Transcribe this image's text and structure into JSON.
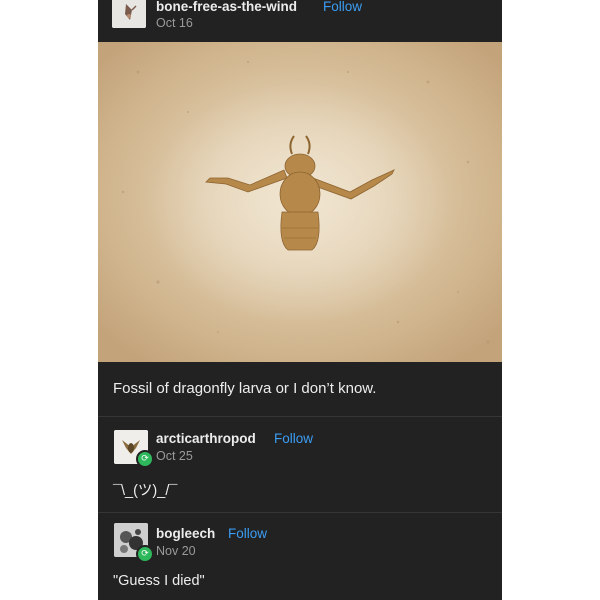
{
  "post": {
    "author": {
      "username": "bone-free-as-the-wind",
      "follow_label": "Follow",
      "date": "Oct 16"
    },
    "image": {
      "subject": "fossil",
      "background_color": "#cbb08d"
    },
    "caption": "Fossil of dragonfly larva or I don’t know."
  },
  "reblogs": [
    {
      "username": "arcticarthropod",
      "follow_label": "Follow",
      "date": "Oct 25",
      "text": "¯\\_(ツ)_/¯",
      "badge_icon": "reblog-icon"
    },
    {
      "username": "bogleech",
      "follow_label": "Follow",
      "date": "Nov 20",
      "text": "\"Guess I died\"",
      "badge_icon": "reblog-icon"
    }
  ],
  "colors": {
    "post_background": "#222222",
    "follow_link": "#3b9cf2",
    "date_text": "#9a9a9a",
    "reblog_badge": "#2eb85c"
  }
}
